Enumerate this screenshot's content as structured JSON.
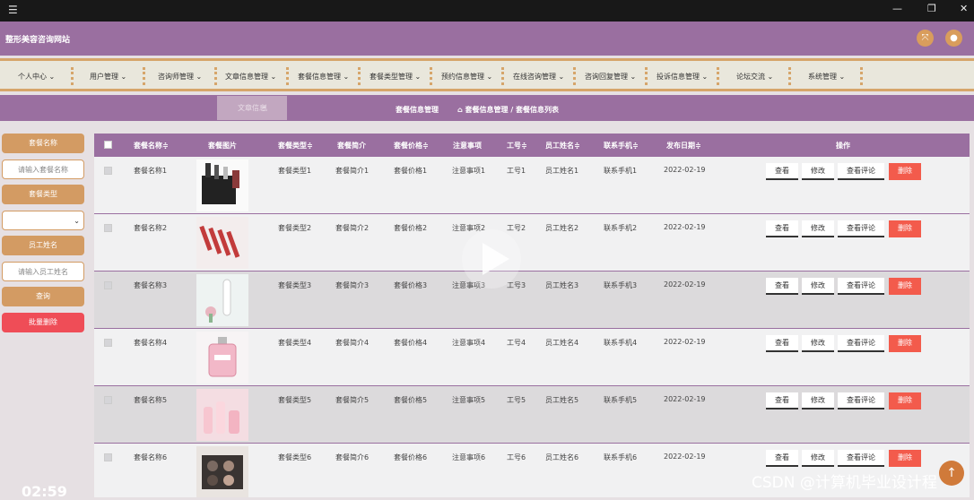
{
  "window": {
    "minimize": "—",
    "restore": "❐",
    "close": "✕",
    "menu": "☰"
  },
  "header": {
    "site_title": "整形美容咨询网站"
  },
  "nav": {
    "items": [
      "个人中心",
      "用户管理",
      "咨询师管理",
      "文章信息管理",
      "套餐信息管理",
      "套餐类型管理",
      "预约信息管理",
      "在线咨询管理",
      "咨询回复管理",
      "投诉信息管理",
      "论坛交流",
      "系统管理"
    ],
    "arrow": "⌄"
  },
  "subbar": {
    "tab_label": "文章信息",
    "section_title": "套餐信息管理",
    "breadcrumb": "套餐信息管理 / 套餐信息列表"
  },
  "search": {
    "name_label": "套餐名称",
    "name_placeholder": "请输入套餐名称",
    "type_label": "套餐类型",
    "type_selected": "",
    "staff_label": "员工姓名",
    "staff_placeholder": "请输入员工姓名",
    "query_button": "查询",
    "batch_delete_button": "批量删除"
  },
  "table": {
    "headers": [
      "套餐名称≑",
      "套餐图片",
      "套餐类型≑",
      "套餐简介",
      "套餐价格≑",
      "注意事项",
      "工号≑",
      "员工姓名≑",
      "联系手机≑",
      "发布日期≑",
      "操作"
    ],
    "rows": [
      {
        "name": "套餐名称1",
        "type": "套餐类型1",
        "intro": "套餐简介1",
        "price": "套餐价格1",
        "note": "注意事项1",
        "no": "工号1",
        "staff": "员工姓名1",
        "phone": "联系手机1",
        "date": "2022-02-19"
      },
      {
        "name": "套餐名称2",
        "type": "套餐类型2",
        "intro": "套餐简介2",
        "price": "套餐价格2",
        "note": "注意事项2",
        "no": "工号2",
        "staff": "员工姓名2",
        "phone": "联系手机2",
        "date": "2022-02-19"
      },
      {
        "name": "套餐名称3",
        "type": "套餐类型3",
        "intro": "套餐简介3",
        "price": "套餐价格3",
        "note": "注意事项3",
        "no": "工号3",
        "staff": "员工姓名3",
        "phone": "联系手机3",
        "date": "2022-02-19"
      },
      {
        "name": "套餐名称4",
        "type": "套餐类型4",
        "intro": "套餐简介4",
        "price": "套餐价格4",
        "note": "注意事项4",
        "no": "工号4",
        "staff": "员工姓名4",
        "phone": "联系手机4",
        "date": "2022-02-19"
      },
      {
        "name": "套餐名称5",
        "type": "套餐类型5",
        "intro": "套餐简介5",
        "price": "套餐价格5",
        "note": "注意事项5",
        "no": "工号5",
        "staff": "员工姓名5",
        "phone": "联系手机5",
        "date": "2022-02-19"
      },
      {
        "name": "套餐名称6",
        "type": "套餐类型6",
        "intro": "套餐简介6",
        "price": "套餐价格6",
        "note": "注意事项6",
        "no": "工号6",
        "staff": "员工姓名6",
        "phone": "联系手机6",
        "date": "2022-02-19"
      }
    ],
    "actions": {
      "view": "查看",
      "edit": "修改",
      "comments": "查看评论",
      "delete": "删除"
    }
  },
  "overlay": {
    "timer": "02:59",
    "watermark": "CSDN @计算机毕业设计程"
  },
  "colors": {
    "primary": "#9a6fa0",
    "accent": "#d39b63",
    "danger": "#ef4d57"
  }
}
